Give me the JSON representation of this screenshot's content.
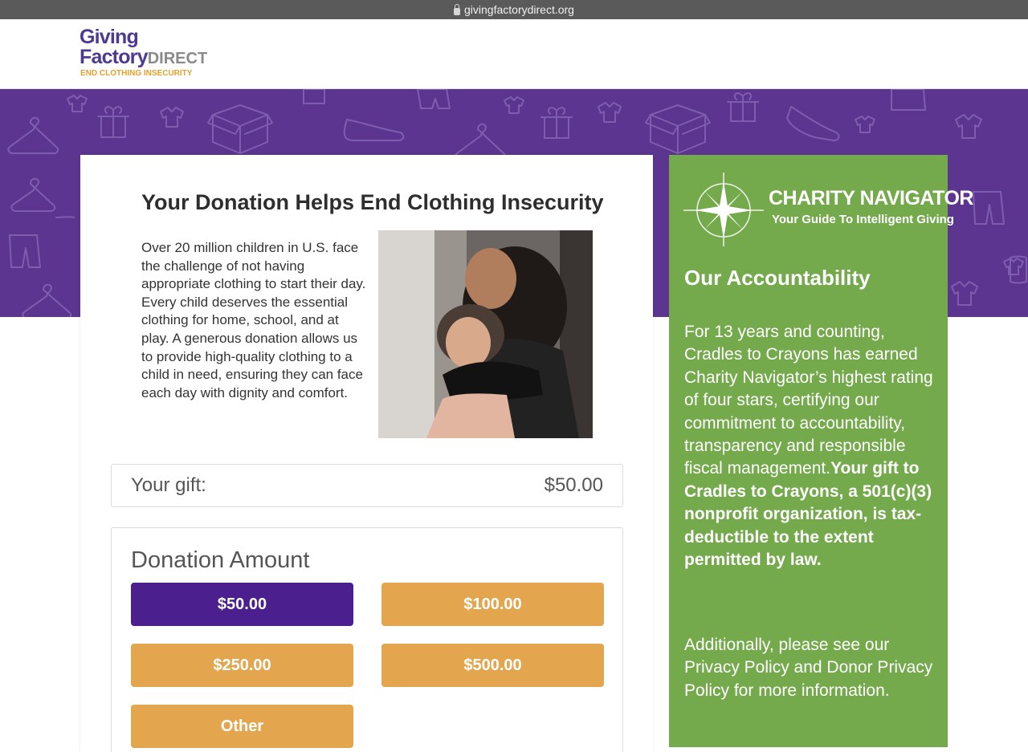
{
  "browser": {
    "url": "givingfactorydirect.org"
  },
  "logo": {
    "line1": "Giving",
    "line2a": "Factory",
    "line2b": "DIRECT",
    "tagline": "END CLOTHING INSECURITY"
  },
  "colors": {
    "purple": "#5b3590",
    "selected": "#4b1f8e",
    "orange": "#e3a64e",
    "green": "#74a94c"
  },
  "main": {
    "title": "Your Donation Helps End Clothing Insecurity",
    "intro": "Over 20 million children in U.S. face the challenge of not having appropriate clothing to start their day. Every child deserves the essential clothing for home, school, and at play. A generous donation allows us to provide high-quality clothing to a child in need, ensuring they can face each day with dignity and comfort.",
    "gift_label": "Your gift:",
    "gift_value": "$50.00",
    "amount_title": "Donation Amount",
    "amounts": [
      "$50.00",
      "$100.00",
      "$250.00",
      "$500.00",
      "Other"
    ],
    "selected_amount": "$50.00"
  },
  "sidebar": {
    "badge_title": "CHARITY NAVIGATOR",
    "badge_subtitle": "Your Guide To Intelligent Giving",
    "title": "Our Accountability",
    "text": "For 13 years and counting, Cradles to Crayons has earned Charity Navigator’s highest rating of four stars, certifying our commitment to accountability, transparency and responsible fiscal management.",
    "text_bold": "Your gift to Cradles to Crayons, a 501(c)(3) nonprofit organization, is tax-deductible to the extent permitted by law.",
    "more": "Additionally, please see our Privacy Policy and Donor Privacy Policy for more information."
  }
}
